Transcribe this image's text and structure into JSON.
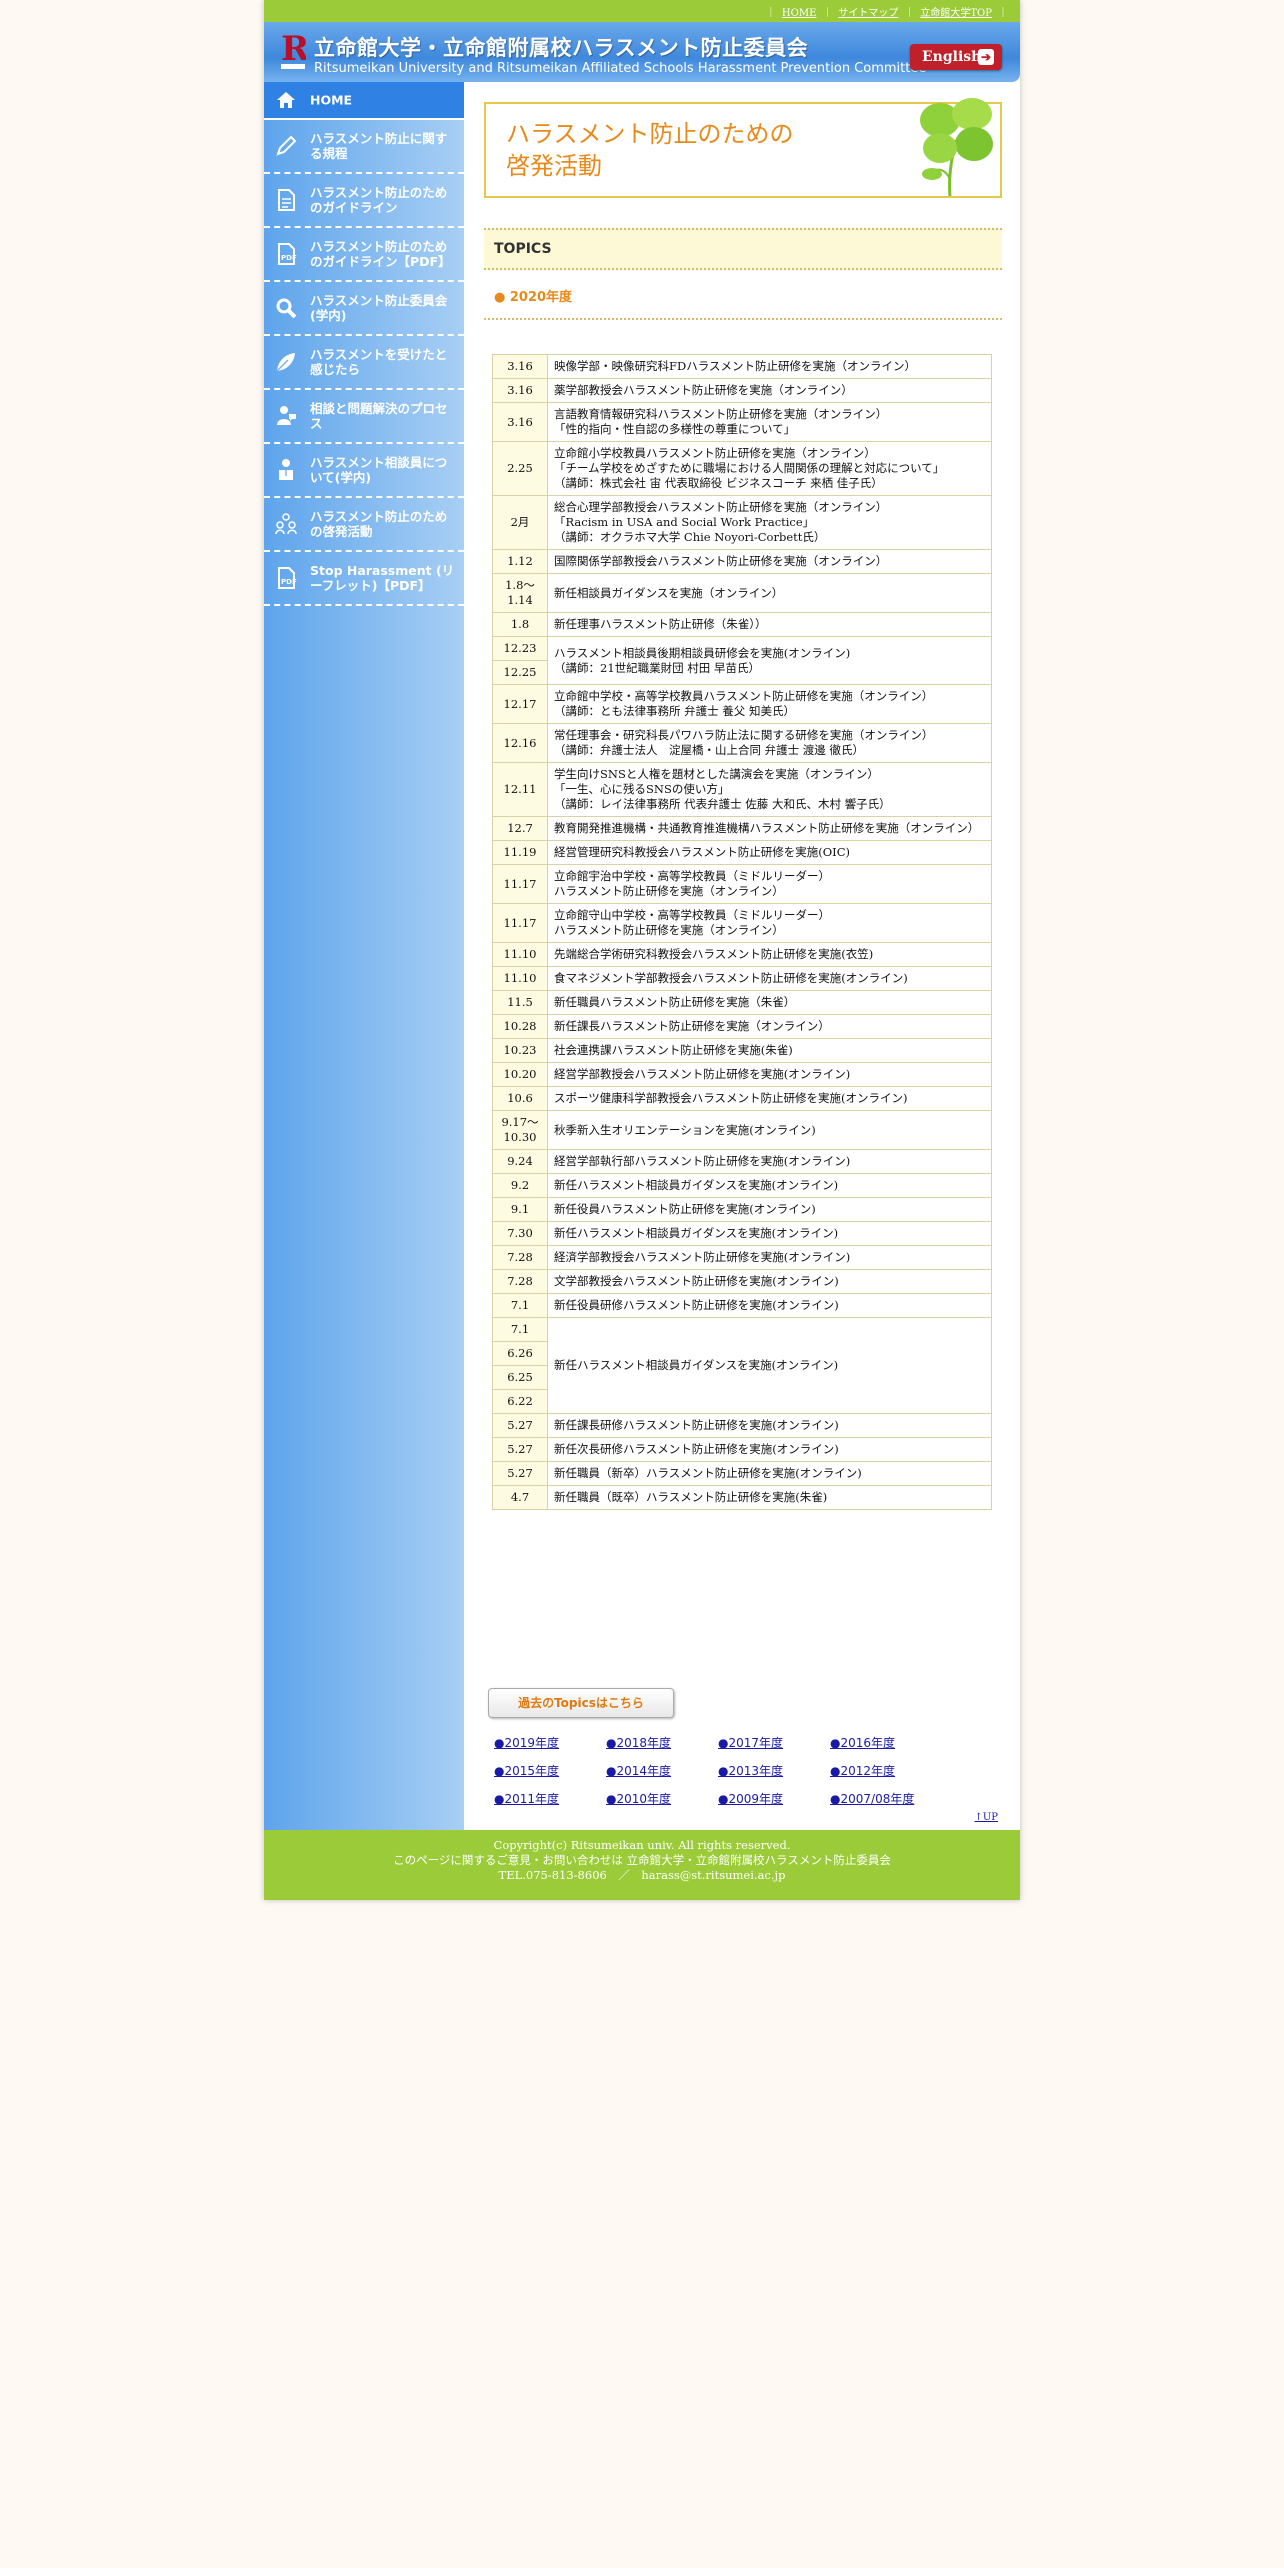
{
  "topbar": {
    "links": [
      "HOME",
      "サイトマップ",
      "立命館大学TOP"
    ]
  },
  "header": {
    "title_ja": "立命館大学・立命館附属校ハラスメント防止委員会",
    "title_en": "Ritsumeikan University and Ritsumeikan Affiliated Schools Harassment Prevention Committee",
    "english_label": "English"
  },
  "sidebar": {
    "items": [
      {
        "label": "HOME",
        "icon": "home-icon"
      },
      {
        "label": "ハラスメント防止に関する規程",
        "icon": "pencil-icon"
      },
      {
        "label": "ハラスメント防止のためのガイドライン",
        "icon": "document-icon"
      },
      {
        "label": "ハラスメント防止のためのガイドライン【PDF】",
        "icon": "pdf-icon"
      },
      {
        "label": "ハラスメント防止委員会(学内)",
        "icon": "search-icon"
      },
      {
        "label": "ハラスメントを受けたと感じたら",
        "icon": "leaf-icon"
      },
      {
        "label": "相談と問題解決のプロセス",
        "icon": "consult-icon"
      },
      {
        "label": "ハラスメント相談員について(学内)",
        "icon": "person-icon"
      },
      {
        "label": "ハラスメント防止のための啓発活動",
        "icon": "group-icon"
      },
      {
        "label": "Stop Harassment (リーフレット)【PDF】",
        "icon": "pdf-icon"
      }
    ]
  },
  "main": {
    "banner_title_line1": "ハラスメント防止のための",
    "banner_title_line2": "啓発活動",
    "topics_heading": "TOPICS",
    "year_heading": "● 2020年度",
    "rows": [
      {
        "date": "3.16",
        "text": "映像学部・映像研究科FDハラスメント防止研修を実施（オンライン）"
      },
      {
        "date": "3.16",
        "text": "薬学部教授会ハラスメント防止研修を実施（オンライン）"
      },
      {
        "date": "3.16",
        "text": "言語教育情報研究科ハラスメント防止研修を実施（オンライン）\n「性的指向・性自認の多様性の尊重について」"
      },
      {
        "date": "2.25",
        "text": "立命館小学校教員ハラスメント防止研修を実施（オンライン）\n「チーム学校をめざすために職場における人間関係の理解と対応について」\n（講師：株式会社 宙 代表取締役 ビジネスコーチ 来栖 佳子氏）"
      },
      {
        "date": "2月",
        "text": "総合心理学部教授会ハラスメント防止研修を実施（オンライン）\n「Racism in USA and Social Work Practice」\n（講師：オクラホマ大学 Chie Noyori-Corbett氏）"
      },
      {
        "date": "1.12",
        "text": "国際関係学部教授会ハラスメント防止研修を実施（オンライン）"
      },
      {
        "date": "1.8～1.14",
        "text": "新任相談員ガイダンスを実施（オンライン）"
      },
      {
        "date": "1.8",
        "text": "新任理事ハラスメント防止研修（朱雀））"
      },
      {
        "date": "12.23",
        "text": "ハラスメント相談員後期相談員研修会を実施(オンライン)\n（講師：21世紀職業財団 村田 早苗氏）",
        "extra_date": "12.25"
      },
      {
        "date": "12.17",
        "text": "立命館中学校・高等学校教員ハラスメント防止研修を実施（オンライン）\n（講師：とも法律事務所 弁護士 養父 知美氏）"
      },
      {
        "date": "12.16",
        "text": "常任理事会・研究科長パワハラ防止法に関する研修を実施（オンライン）\n（講師：弁護士法人　淀屋橋・山上合同 弁護士 渡邊 徹氏）"
      },
      {
        "date": "12.11",
        "text": "学生向けSNSと人権を題材とした講演会を実施（オンライン）\n「一生、心に残るSNSの使い方」\n（講師：レイ法律事務所 代表弁護士 佐藤 大和氏、木村 響子氏）"
      },
      {
        "date": "12.7",
        "text": "教育開発推進機構・共通教育推進機構ハラスメント防止研修を実施（オンライン）"
      },
      {
        "date": "11.19",
        "text": "経営管理研究科教授会ハラスメント防止研修を実施(OIC)"
      },
      {
        "date": "11.17",
        "text": "立命館宇治中学校・高等学校教員（ミドルリーダー）\nハラスメント防止研修を実施（オンライン）"
      },
      {
        "date": "11.17",
        "text": "立命館守山中学校・高等学校教員（ミドルリーダー）\nハラスメント防止研修を実施（オンライン）"
      },
      {
        "date": "11.10",
        "text": "先端総合学術研究科教授会ハラスメント防止研修を実施(衣笠)"
      },
      {
        "date": "11.10",
        "text": "食マネジメント学部教授会ハラスメント防止研修を実施(オンライン)"
      },
      {
        "date": "11.5",
        "text": "新任職員ハラスメント防止研修を実施（朱雀）"
      },
      {
        "date": "10.28",
        "text": "新任課長ハラスメント防止研修を実施（オンライン）"
      },
      {
        "date": "10.23",
        "text": "社会連携課ハラスメント防止研修を実施(朱雀)"
      },
      {
        "date": "10.20",
        "text": "経営学部教授会ハラスメント防止研修を実施(オンライン)"
      },
      {
        "date": "10.6",
        "text": "スポーツ健康科学部教授会ハラスメント防止研修を実施(オンライン)"
      },
      {
        "date": "9.17～10.30",
        "text": "秋季新入生オリエンテーションを実施(オンライン)"
      },
      {
        "date": "9.24",
        "text": "経営学部執行部ハラスメント防止研修を実施(オンライン)"
      },
      {
        "date": "9.2",
        "text": "新任ハラスメント相談員ガイダンスを実施(オンライン)"
      },
      {
        "date": "9.1",
        "text": "新任役員ハラスメント防止研修を実施(オンライン)"
      },
      {
        "date": "7.30",
        "text": "新任ハラスメント相談員ガイダンスを実施(オンライン)"
      },
      {
        "date": "7.28",
        "text": "経済学部教授会ハラスメント防止研修を実施(オンライン)"
      },
      {
        "date": "7.28",
        "text": "文学部教授会ハラスメント防止研修を実施(オンライン)"
      },
      {
        "date": "7.1",
        "text": "新任役員研修ハラスメント防止研修を実施(オンライン)"
      },
      {
        "date": "7.1",
        "text": "新任ハラスメント相談員ガイダンスを実施(オンライン)",
        "extra_dates": [
          "6.26",
          "6.25",
          "6.22"
        ]
      },
      {
        "date": "5.27",
        "text": "新任課長研修ハラスメント防止研修を実施(オンライン)"
      },
      {
        "date": "5.27",
        "text": "新任次長研修ハラスメント防止研修を実施(オンライン)"
      },
      {
        "date": "5.27",
        "text": "新任職員（新卒）ハラスメント防止研修を実施(オンライン)"
      },
      {
        "date": "4.7",
        "text": "新任職員（既卒）ハラスメント防止研修を実施(朱雀)"
      }
    ],
    "past_button": "過去のTopicsはこちら",
    "years": [
      "2019年度",
      "2018年度",
      "2017年度",
      "2016年度",
      "2015年度",
      "2014年度",
      "2013年度",
      "2012年度",
      "2011年度",
      "2010年度",
      "2009年度",
      "2007/08年度"
    ],
    "up_label": "↑UP"
  },
  "footer": {
    "copyright": "Copyright(c) Ritsumeikan univ. All rights reserved.",
    "contact": "このページに関するご意見・お問い合わせは 立命館大学・立命館附属校ハラスメント防止委員会",
    "tel_email": "TEL.075-813-8606　／　harass@st.ritsumei.ac.jp"
  },
  "colors": {
    "green": "#9ccb3a",
    "blue": "#3f88dc",
    "orange": "#e88a1a",
    "red": "#c0202a"
  }
}
